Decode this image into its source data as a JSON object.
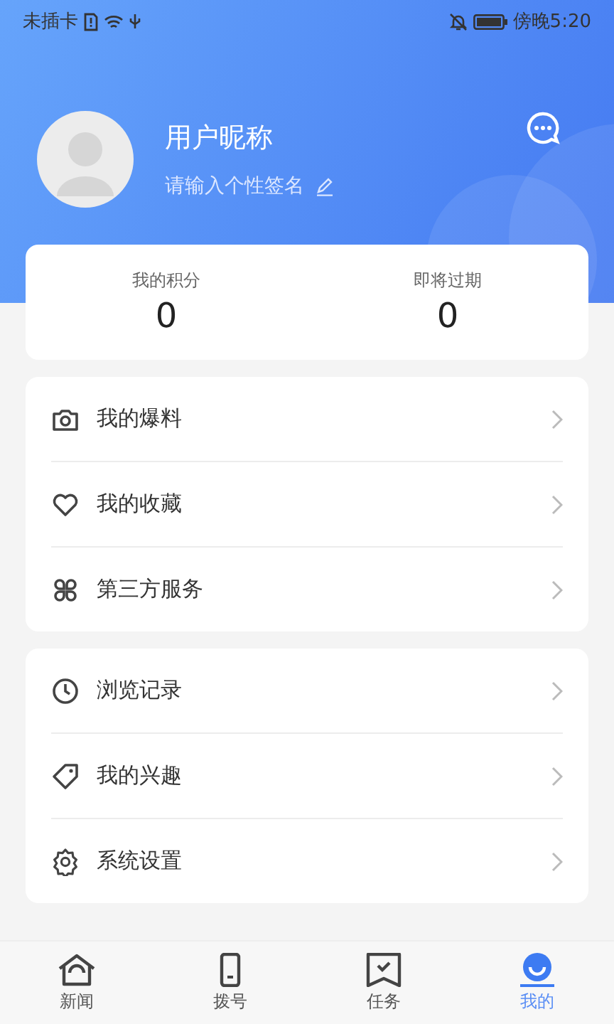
{
  "status_bar": {
    "carrier": "未插卡",
    "time": "傍晚5:20"
  },
  "profile": {
    "nickname": "用户昵称",
    "signature_placeholder": "请输入个性签名"
  },
  "stats": [
    {
      "label": "我的积分",
      "value": "0"
    },
    {
      "label": "即将过期",
      "value": "0"
    }
  ],
  "menu_groups": [
    [
      {
        "kind": "camera",
        "label": "我的爆料"
      },
      {
        "kind": "heart",
        "label": "我的收藏"
      },
      {
        "kind": "apps",
        "label": "第三方服务"
      }
    ],
    [
      {
        "kind": "clock",
        "label": "浏览记录"
      },
      {
        "kind": "tag",
        "label": "我的兴趣"
      },
      {
        "kind": "gear",
        "label": "系统设置"
      }
    ]
  ],
  "tabs": [
    {
      "kind": "home",
      "label": "新闻",
      "selected": false
    },
    {
      "kind": "phone",
      "label": "拨号",
      "selected": false
    },
    {
      "kind": "task",
      "label": "任务",
      "selected": false
    },
    {
      "kind": "me",
      "label": "我的",
      "selected": true
    }
  ]
}
